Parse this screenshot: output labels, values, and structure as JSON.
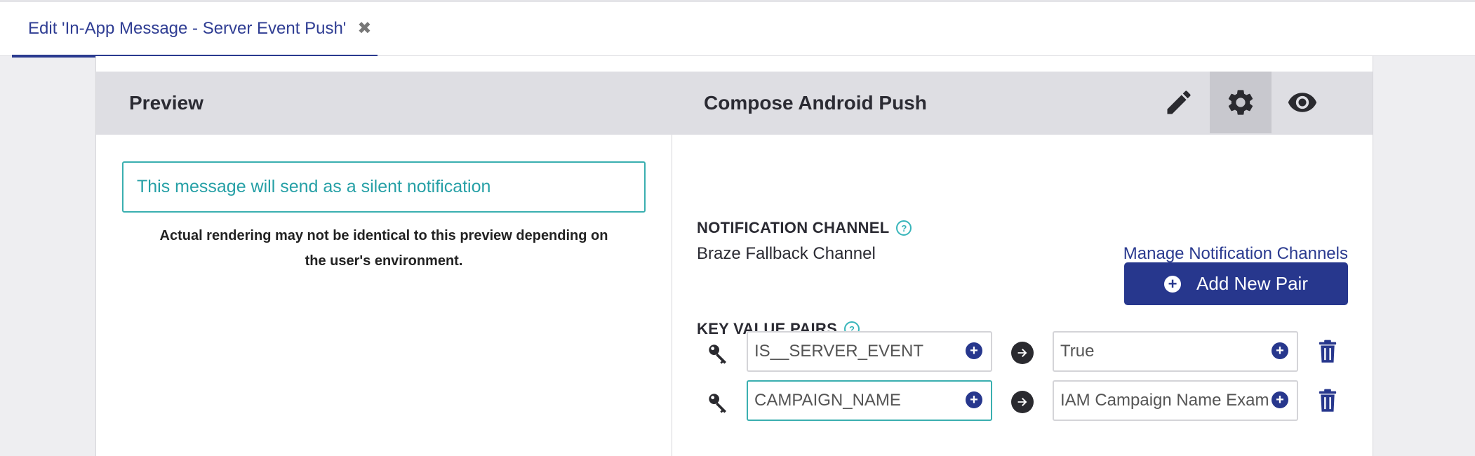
{
  "tab": {
    "label": "Edit 'In-App Message - Server Event Push'",
    "close_symbol": "✖"
  },
  "header": {
    "preview_title": "Preview",
    "compose_title": "Compose Android Push",
    "tools": [
      "pencil-icon",
      "gear-icon",
      "eye-icon"
    ],
    "active_tool": "gear-icon"
  },
  "preview": {
    "silent_message": "This message will send as a silent notification",
    "render_note_line1": "Actual rendering may not be identical to this preview depending on",
    "render_note_line2": "the user's environment."
  },
  "compose": {
    "notification_channel": {
      "label": "NOTIFICATION CHANNEL",
      "help": "?",
      "value": "Braze Fallback Channel",
      "manage_link": "Manage Notification Channels"
    },
    "key_value_pairs": {
      "label": "KEY VALUE PAIRS",
      "help": "?",
      "add_button": "Add New Pair",
      "add_plus": "+",
      "pairs": [
        {
          "key": "IS__SERVER_EVENT",
          "value": "True"
        },
        {
          "key": "CAMPAIGN_NAME",
          "value": "IAM Campaign Name Example"
        }
      ]
    }
  },
  "colors": {
    "accent": "#27378d",
    "teal": "#3aafb0",
    "header_bg": "#dedee3"
  }
}
